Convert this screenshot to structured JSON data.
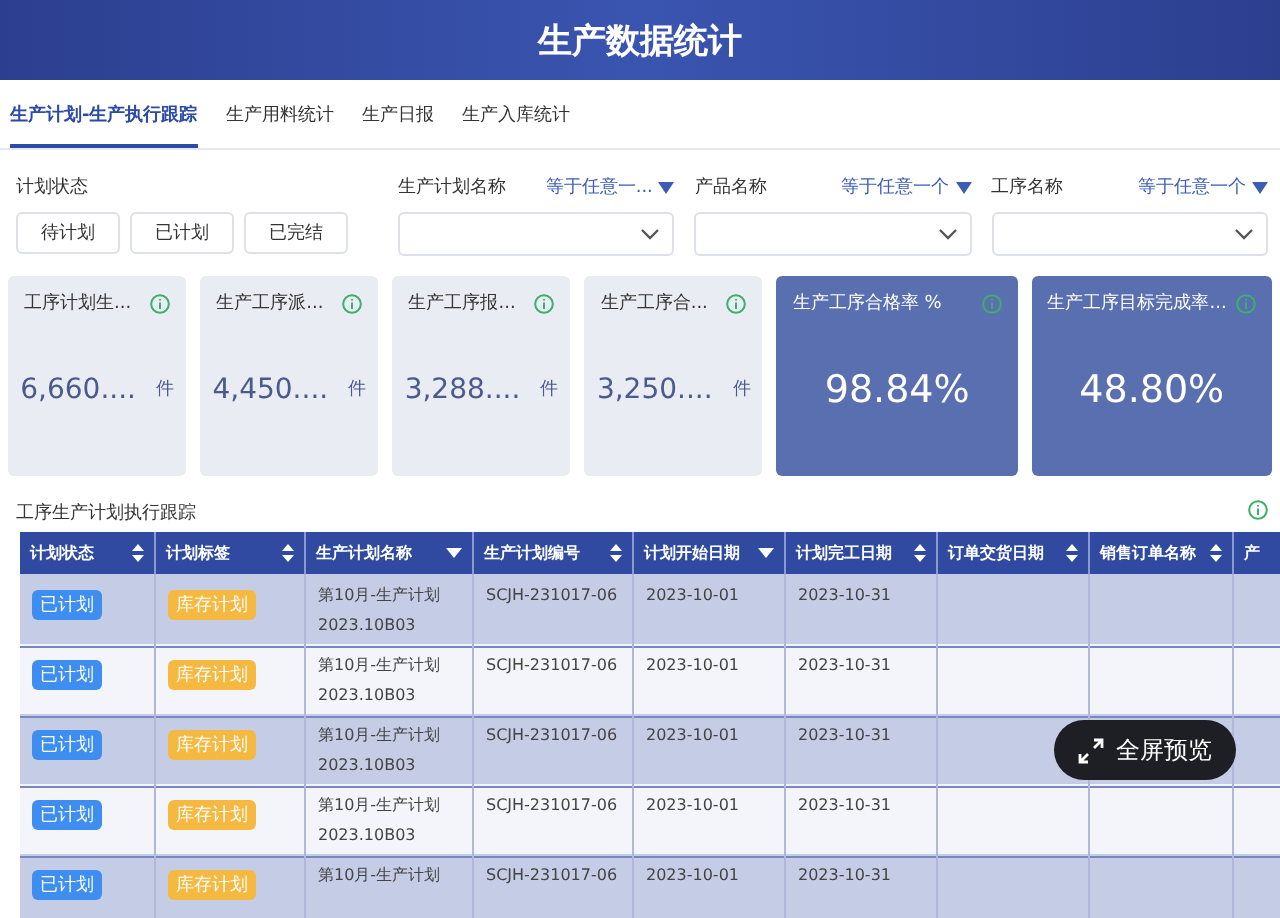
{
  "header": {
    "title": "生产数据统计"
  },
  "tabs": [
    {
      "label": "生产计划-生产执行跟踪",
      "selected": true
    },
    {
      "label": "生产用料统计",
      "selected": false
    },
    {
      "label": "生产日报",
      "selected": false
    },
    {
      "label": "生产入库统计",
      "selected": false
    }
  ],
  "status_filter": {
    "label": "计划状态",
    "options": [
      "待计划",
      "已计划",
      "已完结"
    ]
  },
  "filters": [
    {
      "label": "生产计划名称",
      "operator": "等于任意一..."
    },
    {
      "label": "产品名称",
      "operator": "等于任意一个"
    },
    {
      "label": "工序名称",
      "operator": "等于任意一个"
    }
  ],
  "cards": [
    {
      "kind": "plain",
      "title": "工序计划生...",
      "value": "6,660....",
      "unit": "件"
    },
    {
      "kind": "plain",
      "title": "生产工序派...",
      "value": "4,450....",
      "unit": "件"
    },
    {
      "kind": "plain",
      "title": "生产工序报...",
      "value": "3,288....",
      "unit": "件"
    },
    {
      "kind": "plain",
      "title": "生产工序合...",
      "value": "3,250....",
      "unit": "件"
    },
    {
      "kind": "highlight",
      "title": "生产工序合格率 %",
      "value": "98.84%"
    },
    {
      "kind": "highlight",
      "title": "生产工序目标完成率...",
      "value": "48.80%"
    }
  ],
  "table": {
    "title": "工序生产计划执行跟踪",
    "columns": [
      {
        "label": "计划状态",
        "kind": "sort"
      },
      {
        "label": "计划标签",
        "kind": "sort"
      },
      {
        "label": "生产计划名称",
        "kind": "menu"
      },
      {
        "label": "生产计划编号",
        "kind": "sort"
      },
      {
        "label": "计划开始日期",
        "kind": "menu"
      },
      {
        "label": "计划完工日期",
        "kind": "sort"
      },
      {
        "label": "订单交货日期",
        "kind": "sort"
      },
      {
        "label": "销售订单名称",
        "kind": "sort"
      },
      {
        "label": "产",
        "kind": "plain"
      }
    ],
    "rows": [
      {
        "status": "已计划",
        "tag": "库存计划",
        "name": "第10月-生产计划 2023.10B03",
        "code": "SCJH-231017-06",
        "start": "2023-10-01",
        "end": "2023-10-31"
      },
      {
        "status": "已计划",
        "tag": "库存计划",
        "name": "第10月-生产计划 2023.10B03",
        "code": "SCJH-231017-06",
        "start": "2023-10-01",
        "end": "2023-10-31"
      },
      {
        "status": "已计划",
        "tag": "库存计划",
        "name": "第10月-生产计划 2023.10B03",
        "code": "SCJH-231017-06",
        "start": "2023-10-01",
        "end": "2023-10-31"
      },
      {
        "status": "已计划",
        "tag": "库存计划",
        "name": "第10月-生产计划 2023.10B03",
        "code": "SCJH-231017-06",
        "start": "2023-10-01",
        "end": "2023-10-31"
      },
      {
        "status": "已计划",
        "tag": "库存计划",
        "name": "第10月-生产计划",
        "code": "SCJH-231017-06",
        "start": "2023-10-01",
        "end": "2023-10-31"
      }
    ]
  },
  "fullscreen_button": "全屏预览"
}
